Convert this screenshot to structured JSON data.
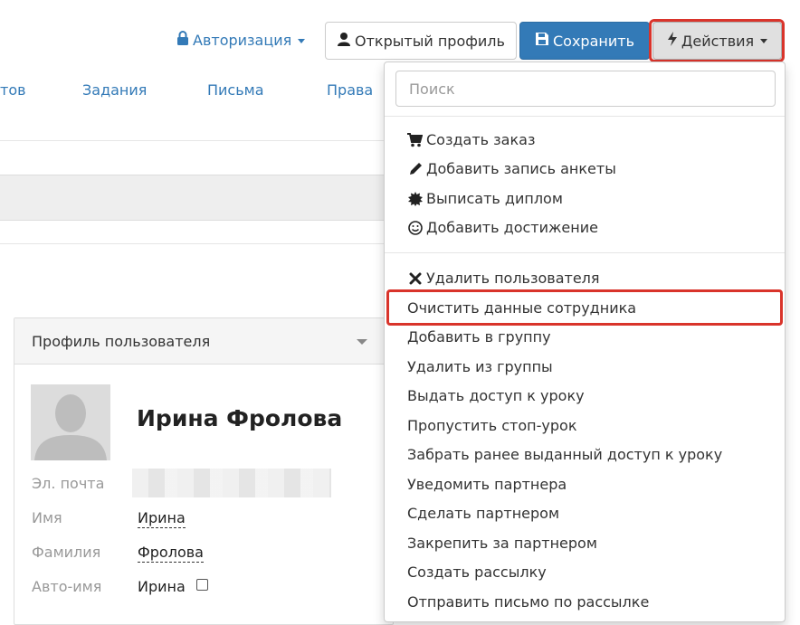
{
  "header": {
    "auth_label": "Авторизация",
    "open_profile_label": "Открытый профиль",
    "save_label": "Сохранить",
    "actions_label": "Действия"
  },
  "nav": {
    "tabs": [
      {
        "label": "тов"
      },
      {
        "label": "Задания"
      },
      {
        "label": "Письма"
      },
      {
        "label": "Права"
      }
    ]
  },
  "panel": {
    "title": "Профиль пользователя",
    "user_name": "Ирина Фролова",
    "fields": [
      {
        "label": "Эл. почта",
        "value": ""
      },
      {
        "label": "Имя",
        "value": "Ирина"
      },
      {
        "label": "Фамилия",
        "value": "Фролова"
      },
      {
        "label": "Авто-имя",
        "value": "Ирина"
      }
    ]
  },
  "dropdown": {
    "search_placeholder": "Поиск",
    "group1": [
      {
        "label": "Создать заказ",
        "icon": "cart-icon"
      },
      {
        "label": "Добавить запись анкеты",
        "icon": "pencil-icon"
      },
      {
        "label": "Выписать диплом",
        "icon": "certificate-icon"
      },
      {
        "label": "Добавить достижение",
        "icon": "smile-icon"
      }
    ],
    "group2": [
      {
        "label": "Удалить пользователя",
        "icon": "close-icon"
      },
      {
        "label": "Очистить данные сотрудника"
      },
      {
        "label": "Добавить в группу"
      },
      {
        "label": "Удалить из группы"
      },
      {
        "label": "Выдать доступ к уроку"
      },
      {
        "label": "Пропустить стоп-урок"
      },
      {
        "label": "Забрать ранее выданный доступ к уроку"
      },
      {
        "label": "Уведомить партнера"
      },
      {
        "label": "Сделать партнером"
      },
      {
        "label": "Закрепить за партнером"
      },
      {
        "label": "Создать рассылку"
      },
      {
        "label": "Отправить письмо по рассылке"
      }
    ]
  },
  "colors": {
    "primary": "#337ab7",
    "highlight": "#d9342b"
  }
}
